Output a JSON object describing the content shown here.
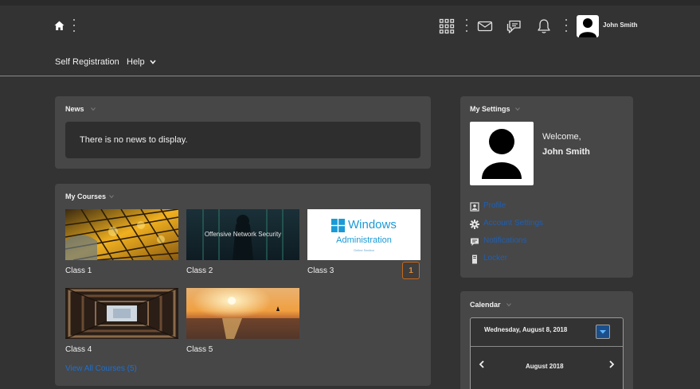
{
  "header": {
    "user_name": "John Smith",
    "icons": [
      "home-icon",
      "apps-grid-icon",
      "mail-icon",
      "chat-icon",
      "bell-icon"
    ]
  },
  "nav": {
    "self_registration": "Self Registration",
    "help": "Help"
  },
  "news": {
    "title": "News",
    "empty_message": "There is no news to display."
  },
  "courses": {
    "title": "My Courses",
    "items": [
      {
        "label": "Class 1"
      },
      {
        "label": "Class 2",
        "image_text": "Offensive Network Security"
      },
      {
        "label": "Class 3",
        "image_title": "Windows",
        "image_subtitle": "Administration",
        "image_caption": "Online Section",
        "badge": "1"
      },
      {
        "label": "Class 4"
      },
      {
        "label": "Class 5"
      }
    ],
    "view_all": "View All Courses (5)"
  },
  "settings": {
    "title": "My Settings",
    "welcome": "Welcome,",
    "user_name": "John Smith",
    "links": [
      "Profile",
      "Account Settings",
      "Notifications",
      "Locker"
    ]
  },
  "calendar": {
    "title": "Calendar",
    "selected_date": "Wednesday, August 8, 2018",
    "month": "August 2018"
  },
  "colors": {
    "background": "#333333",
    "panel": "#474747",
    "link": "#1e6fd0",
    "badge": "#c8691c"
  }
}
